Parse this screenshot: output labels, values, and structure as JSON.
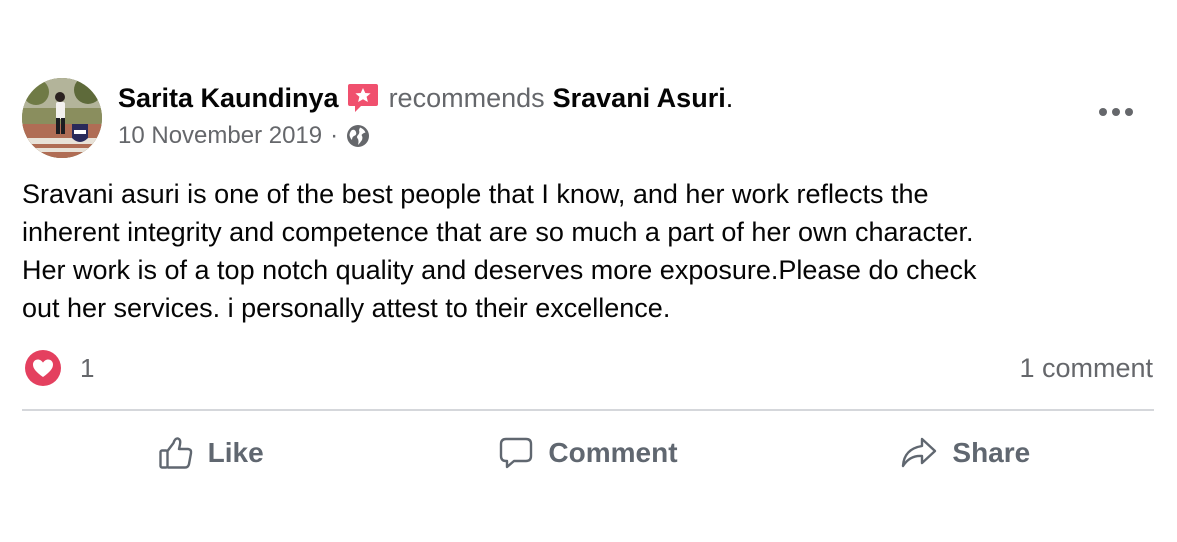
{
  "post": {
    "author": "Sarita Kaundinya",
    "verb": "recommends",
    "target": "Sravani Asuri",
    "target_suffix": ".",
    "date": "10 November 2019",
    "separator": "·",
    "privacy_icon": "globe-icon",
    "badge_icon": "star-recommendation-icon",
    "more_icon": "ellipsis-icon",
    "body_lines": [
      "Sravani asuri is one of the best people that I know, and her work reflects the",
      "inherent integrity and competence that are so much a part of her own character.",
      "Her work is of a top notch quality and deserves more exposure.Please do check",
      "out her services. i personally attest to their excellence."
    ]
  },
  "reactions": {
    "icon": "heart-reaction-icon",
    "count": "1",
    "comments": "1 comment"
  },
  "actions": {
    "like": "Like",
    "comment": "Comment",
    "share": "Share"
  },
  "colors": {
    "secondary_text": "#65676b",
    "badge": "#f0506e",
    "heart": "#e4405f",
    "divider": "#d5d7db"
  }
}
